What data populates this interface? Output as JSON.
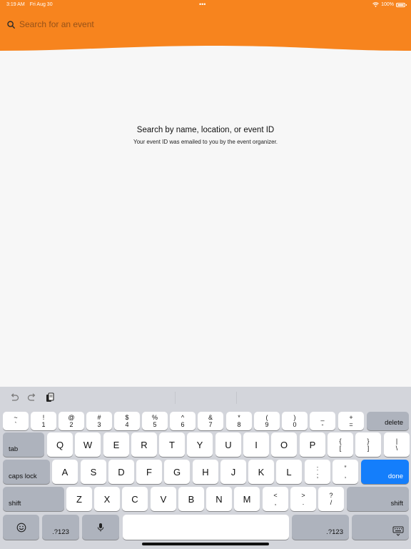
{
  "status_bar": {
    "time": "3:19 AM",
    "date": "Fri Aug 30",
    "battery": "100%"
  },
  "colors": {
    "header": "#f7841e",
    "accent": "#147efb"
  },
  "search": {
    "placeholder": "Search for an event",
    "icon": "search-icon"
  },
  "empty_state": {
    "title": "Search by name, location, or event ID",
    "subtitle": "Your event ID was emailed to you by the event organizer."
  },
  "keyboard": {
    "toolbar": [
      "undo-icon",
      "redo-icon",
      "paste-icon"
    ],
    "number_row": [
      {
        "top": "~",
        "bottom": "`"
      },
      {
        "top": "!",
        "bottom": "1"
      },
      {
        "top": "@",
        "bottom": "2"
      },
      {
        "top": "#",
        "bottom": "3"
      },
      {
        "top": "$",
        "bottom": "4"
      },
      {
        "top": "%",
        "bottom": "5"
      },
      {
        "top": "^",
        "bottom": "6"
      },
      {
        "top": "&",
        "bottom": "7"
      },
      {
        "top": "*",
        "bottom": "8"
      },
      {
        "top": "(",
        "bottom": "9"
      },
      {
        "top": ")",
        "bottom": "0"
      },
      {
        "top": "_",
        "bottom": "-"
      },
      {
        "top": "+",
        "bottom": "="
      }
    ],
    "delete": "delete",
    "tab": "tab",
    "row1": [
      "Q",
      "W",
      "E",
      "R",
      "T",
      "Y",
      "U",
      "I",
      "O",
      "P"
    ],
    "row1_punct": [
      {
        "top": "{",
        "bottom": "["
      },
      {
        "top": "}",
        "bottom": "]"
      },
      {
        "top": "|",
        "bottom": "\\"
      }
    ],
    "caps_lock": "caps lock",
    "row2": [
      "A",
      "S",
      "D",
      "F",
      "G",
      "H",
      "J",
      "K",
      "L"
    ],
    "row2_punct": [
      {
        "top": ":",
        "bottom": ";"
      },
      {
        "top": "”",
        "bottom": ","
      }
    ],
    "done": "done",
    "shift": "shift",
    "row3": [
      "Z",
      "X",
      "C",
      "V",
      "B",
      "N",
      "M"
    ],
    "row3_punct": [
      {
        "top": "<",
        "bottom": ","
      },
      {
        "top": ">",
        "bottom": "."
      },
      {
        "top": "?",
        "bottom": "/"
      }
    ],
    "numbers_key": ".?123",
    "bottom_icons": [
      "emoji-icon",
      "microphone-icon",
      "keyboard-dismiss-icon"
    ]
  }
}
